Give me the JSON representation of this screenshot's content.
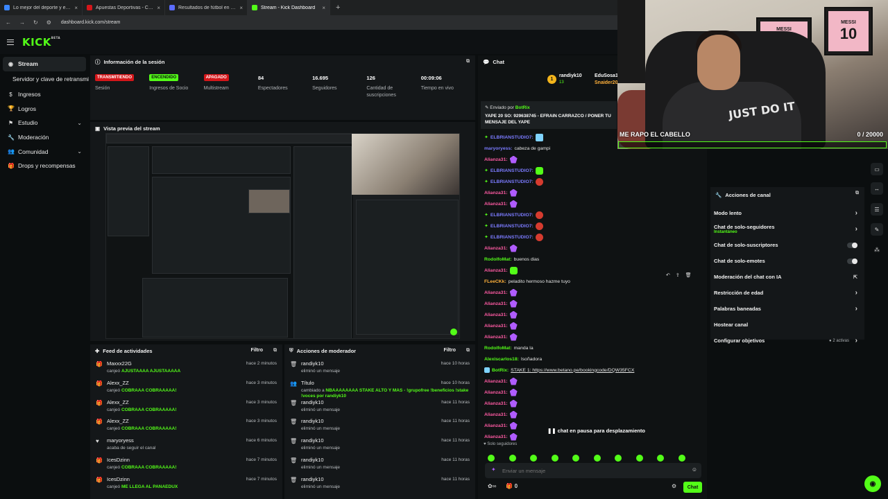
{
  "browser": {
    "tabs": [
      {
        "title": "Lo mejor del deporte y el entre",
        "color": "#3a86ff",
        "active": false
      },
      {
        "title": "Apuestas Deportivas - Casa de",
        "color": "#d4161a",
        "active": false
      },
      {
        "title": "Resultados de fútbol en directo",
        "color": "#5b6cff",
        "active": false
      },
      {
        "title": "Stream - Kick Dashboard",
        "color": "#53fc18",
        "active": true
      }
    ],
    "address": "dashboard.kick.com/stream"
  },
  "app": {
    "logo": "KICK",
    "logo_badge": "BETA"
  },
  "sidebar": {
    "items": [
      {
        "label": "Stream",
        "icon": "stream-icon",
        "active": true,
        "chevron": ""
      },
      {
        "label": "Servidor y clave de retransmisión",
        "icon": "",
        "active": false,
        "sub": true,
        "chevron": ""
      },
      {
        "label": "Ingresos",
        "icon": "dollar-icon",
        "active": false,
        "chevron": ""
      },
      {
        "label": "Logros",
        "icon": "trophy-icon",
        "active": false,
        "chevron": ""
      },
      {
        "label": "Estudio",
        "icon": "studio-icon",
        "active": false,
        "chevron": "⌄"
      },
      {
        "label": "Moderación",
        "icon": "wrench-icon",
        "active": false,
        "chevron": ""
      },
      {
        "label": "Comunidad",
        "icon": "users-icon",
        "active": false,
        "chevron": "⌄"
      },
      {
        "label": "Drops y recompensas",
        "icon": "gift-icon",
        "active": false,
        "chevron": ""
      }
    ]
  },
  "session": {
    "title": "Información de la sesión",
    "stats": [
      {
        "value": "TRANSMITIENDO",
        "badge": "red",
        "label": "Sesión"
      },
      {
        "value": "ENCENDIDO",
        "badge": "green",
        "label": "Ingresos de Socio"
      },
      {
        "value": "APAGADO",
        "badge": "red",
        "label": "Multistream"
      },
      {
        "value": "84",
        "badge": "",
        "label": "Espectadores"
      },
      {
        "value": "16.695",
        "badge": "",
        "label": "Seguidores"
      },
      {
        "value": "126",
        "badge": "",
        "label": "Cantidad de suscripciones"
      },
      {
        "value": "00:09:06",
        "badge": "",
        "label": "Tiempo en vivo"
      }
    ]
  },
  "preview": {
    "title": "Vista previa del stream"
  },
  "feed": {
    "title": "Feed de actividades",
    "filter": "Filtro",
    "items": [
      {
        "user": "Maxxx22G",
        "action": "canjeó",
        "highlight": "AJUSTAAAA AJUSTAAAAA",
        "time": "hace 2 minutos",
        "icon": "gift-icon"
      },
      {
        "user": "Alexx_ZZ",
        "action": "canjeó",
        "highlight": "COBRAAA COBRAAAAA!",
        "time": "hace 3 minutos",
        "icon": "gift-icon"
      },
      {
        "user": "Alexx_ZZ",
        "action": "canjeó",
        "highlight": "COBRAAA COBRAAAAA!",
        "time": "hace 3 minutos",
        "icon": "gift-icon"
      },
      {
        "user": "Alexx_ZZ",
        "action": "canjeó",
        "highlight": "COBRAAA COBRAAAAA!",
        "time": "hace 3 minutos",
        "icon": "gift-icon"
      },
      {
        "user": "maryoryess",
        "action": "acaba de seguir el canal",
        "highlight": "",
        "time": "hace 6 minutos",
        "icon": "heart-icon"
      },
      {
        "user": "IcesDzinn",
        "action": "canjeó",
        "highlight": "COBRAAA COBRAAAAA!",
        "time": "hace 7 minutos",
        "icon": "gift-icon"
      },
      {
        "user": "IcesDzinn",
        "action": "canjeó",
        "highlight": "ME LLEGA AL PANAEDUX",
        "time": "hace 7 minutos",
        "icon": "gift-icon"
      }
    ]
  },
  "modactions": {
    "title": "Acciones de moderador",
    "filter": "Filtro",
    "items": [
      {
        "user": "randiyk10",
        "action": "eliminó un mensaje",
        "highlight": "",
        "time": "hace 10 horas",
        "icon": "trash-icon"
      },
      {
        "user": "Título",
        "action": "cambiado a",
        "highlight": "NBAAAAAAAA STAKE ALTO Y MAS - !grupofree !beneficios !stake !voces por randiyk10",
        "time": "hace 10 horas",
        "icon": "users-icon"
      },
      {
        "user": "randiyk10",
        "action": "eliminó un mensaje",
        "highlight": "",
        "time": "hace 11 horas",
        "icon": "trash-icon"
      },
      {
        "user": "randiyk10",
        "action": "eliminó un mensaje",
        "highlight": "",
        "time": "hace 11 horas",
        "icon": "trash-icon"
      },
      {
        "user": "randiyk10",
        "action": "eliminó un mensaje",
        "highlight": "",
        "time": "hace 11 horas",
        "icon": "trash-icon"
      },
      {
        "user": "randiyk10",
        "action": "eliminó un mensaje",
        "highlight": "",
        "time": "hace 11 horas",
        "icon": "trash-icon"
      },
      {
        "user": "randiyk10",
        "action": "eliminó un mensaje",
        "highlight": "",
        "time": "hace 11 horas",
        "icon": "trash-icon"
      }
    ]
  },
  "chat": {
    "title": "Chat",
    "top_gifter": {
      "user": "randiyk10",
      "count": "13",
      "others": [
        "EduSosa17",
        "Snaider20"
      ]
    },
    "pinned": {
      "sent_by": "Enviado por",
      "bot": "BotRix",
      "text": "YAPE 20 SO: 929638745 - EFRAIN CARRAZCO / PONER TU MENSAJE DEL YAPE"
    },
    "messages": [
      {
        "user": "ELBRIANSTUDIO7",
        "color": "#7b7bff",
        "text": "",
        "emote": "cup",
        "diamond": true
      },
      {
        "user": "maryoryess",
        "color": "#7b7bff",
        "text": "cabeza de gampi",
        "emote": "",
        "diamond": false
      },
      {
        "user": "Alianza31",
        "color": "#ff5ba4",
        "text": "",
        "emote": "pink",
        "diamond": false
      },
      {
        "user": "ELBRIANSTUDIO7",
        "color": "#7b7bff",
        "text": "",
        "emote": "green",
        "diamond": true
      },
      {
        "user": "ELBRIANSTUDIO7",
        "color": "#7b7bff",
        "text": "",
        "emote": "red",
        "diamond": true
      },
      {
        "user": "Alianza31",
        "color": "#ff5ba4",
        "text": "",
        "emote": "pink",
        "diamond": false
      },
      {
        "user": "Alianza31",
        "color": "#ff5ba4",
        "text": "",
        "emote": "pink",
        "diamond": false
      },
      {
        "user": "ELBRIANSTUDIO7",
        "color": "#7b7bff",
        "text": "",
        "emote": "red",
        "diamond": true
      },
      {
        "user": "ELBRIANSTUDIO7",
        "color": "#7b7bff",
        "text": "",
        "emote": "red",
        "diamond": true
      },
      {
        "user": "ELBRIANSTUDIO7",
        "color": "#7b7bff",
        "text": "",
        "emote": "red",
        "diamond": true
      },
      {
        "user": "Alianza31",
        "color": "#ff5ba4",
        "text": "",
        "emote": "pink",
        "diamond": false
      },
      {
        "user": "RodolfoMat",
        "color": "#53fc18",
        "text": "buenos dias",
        "emote": "",
        "diamond": false
      },
      {
        "user": "Alianza31",
        "color": "#ff5ba4",
        "text": "",
        "emote": "green",
        "diamond": false
      },
      {
        "user": "FLeeCKk",
        "color": "#ffb13b",
        "text": "peladito hermoso hazme tuyo",
        "emote": "",
        "diamond": false
      },
      {
        "user": "Alianza31",
        "color": "#ff5ba4",
        "text": "",
        "emote": "pink",
        "diamond": false
      },
      {
        "user": "Alianza31",
        "color": "#ff5ba4",
        "text": "",
        "emote": "pink",
        "diamond": false
      },
      {
        "user": "Alianza31",
        "color": "#ff5ba4",
        "text": "",
        "emote": "pink",
        "diamond": false
      },
      {
        "user": "Alianza31",
        "color": "#ff5ba4",
        "text": "",
        "emote": "pink",
        "diamond": false
      },
      {
        "user": "Alianza31",
        "color": "#ff5ba4",
        "text": "",
        "emote": "pink",
        "diamond": false
      },
      {
        "user": "RodolfoMat",
        "color": "#53fc18",
        "text": "manda la",
        "emote": "",
        "diamond": false
      },
      {
        "user": "Alexiscarlos18",
        "color": "#53fc18",
        "text": "Isoñadora",
        "emote": "",
        "diamond": false
      },
      {
        "user": "BotRix",
        "color": "#53fc18",
        "text": "STAKE 1: https://www.betano.pe/bookingcode/DQW35FCX",
        "emote": "",
        "diamond": false
      },
      {
        "user": "Alianza31",
        "color": "#ff5ba4",
        "text": "",
        "emote": "pink",
        "diamond": false
      },
      {
        "user": "Alianza31",
        "color": "#ff5ba4",
        "text": "",
        "emote": "pink",
        "diamond": false
      },
      {
        "user": "Alianza31",
        "color": "#ff5ba4",
        "text": "",
        "emote": "pink",
        "diamond": false
      },
      {
        "user": "Alianza31",
        "color": "#ff5ba4",
        "text": "",
        "emote": "pink",
        "diamond": false
      },
      {
        "user": "Alianza31",
        "color": "#ff5ba4",
        "text": "",
        "emote": "pink",
        "diamond": false
      },
      {
        "user": "Alianza31",
        "color": "#ff5ba4",
        "text": "",
        "emote": "pink",
        "diamond": false
      }
    ],
    "paused": "chat en pausa para desplazamiento",
    "followers_only": "Solo seguidores",
    "input_placeholder": "Enviar un mensaje",
    "send_label": "Chat",
    "viewer_count": "0"
  },
  "channel_actions": {
    "title": "Acciones de canal",
    "items": [
      {
        "label": "Modo lento",
        "sub": "",
        "control": "chevron"
      },
      {
        "label": "Chat de solo-seguidores",
        "sub": "Instantáneo",
        "control": "chevron"
      },
      {
        "label": "Chat de solo-suscriptores",
        "sub": "",
        "control": "toggle"
      },
      {
        "label": "Chat de solo-emotes",
        "sub": "",
        "control": "toggle"
      },
      {
        "label": "Moderación del chat con IA",
        "sub": "",
        "control": "external"
      },
      {
        "label": "Restricción de edad",
        "sub": "",
        "control": "chevron"
      },
      {
        "label": "Palabras baneadas",
        "sub": "",
        "control": "chevron"
      },
      {
        "label": "Hostear canal",
        "sub": "",
        "control": "none"
      },
      {
        "label": "Configurar objetivos",
        "sub": "",
        "control": "chevron",
        "extra": "2 activas"
      }
    ]
  },
  "webcam": {
    "goal_text": "ME RAPO EL CABELLO",
    "goal_count": "0  /  20000",
    "goal_fraction": 0,
    "jersey_left": "MESSI",
    "jersey_left_num": "10",
    "jersey_right": "MESSI",
    "jersey_right_num": "10",
    "shirt_text": "JUST DO IT"
  },
  "colors": {
    "accent": "#53fc18",
    "live": "#d4161a"
  }
}
